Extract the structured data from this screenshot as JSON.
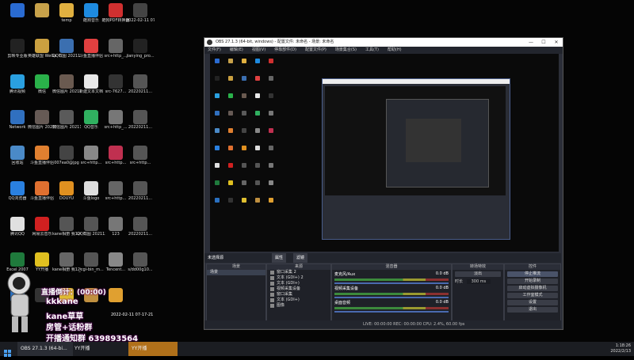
{
  "desktop": {
    "icons": [
      {
        "label": "",
        "color": "#2a6bd1",
        "col": 0,
        "row": 0
      },
      {
        "label": "",
        "color": "#c8a24a",
        "col": 1,
        "row": 0
      },
      {
        "label": "temp",
        "color": "#e0b040",
        "col": 2,
        "row": 0
      },
      {
        "label": "酷狗音乐",
        "color": "#1e8be0",
        "col": 3,
        "row": 0
      },
      {
        "label": "酷狗PDF转换器",
        "color": "#d03030",
        "col": 4,
        "row": 0
      },
      {
        "label": "2022-02-11 07-18-36",
        "color": "#444",
        "col": 5,
        "row": 0
      },
      {
        "label": "剪映专业版",
        "color": "#222",
        "col": 0,
        "row": 1
      },
      {
        "label": "英雄联盟 WeGame版",
        "color": "#caa040",
        "col": 1,
        "row": 1
      },
      {
        "label": "QQ截图 20211218...",
        "color": "#3b6fb0",
        "col": 2,
        "row": 1
      },
      {
        "label": "斗鱼直播伴侣",
        "color": "#e04040",
        "col": 3,
        "row": 1
      },
      {
        "label": "src+http_...",
        "color": "#666",
        "col": 4,
        "row": 1
      },
      {
        "label": "jianying_pro...",
        "color": "#222",
        "col": 5,
        "row": 1
      },
      {
        "label": "腾讯视频",
        "color": "#2aa0e0",
        "col": 0,
        "row": 2
      },
      {
        "label": "微信",
        "color": "#2ab14a",
        "col": 1,
        "row": 2
      },
      {
        "label": "微信图片 20211102...",
        "color": "#6a5a50",
        "col": 2,
        "row": 2
      },
      {
        "label": "新建文本文档",
        "color": "#e8e8e8",
        "col": 3,
        "row": 2
      },
      {
        "label": "src-7627...",
        "color": "#333",
        "col": 4,
        "row": 2
      },
      {
        "label": "20220211...",
        "color": "#555",
        "col": 5,
        "row": 2
      },
      {
        "label": "Network",
        "color": "#3070c0",
        "col": 0,
        "row": 3
      },
      {
        "label": "微信图片 2021110...",
        "color": "#665a55",
        "col": 1,
        "row": 3
      },
      {
        "label": "微信图片 2021110...",
        "color": "#5a5a5a",
        "col": 2,
        "row": 3
      },
      {
        "label": "QQ音乐",
        "color": "#30b060",
        "col": 3,
        "row": 3
      },
      {
        "label": "src+http_...",
        "color": "#777",
        "col": 4,
        "row": 3
      },
      {
        "label": "20220211...",
        "color": "#555",
        "col": 5,
        "row": 3
      },
      {
        "label": "回收站",
        "color": "#4a8ac8",
        "col": 0,
        "row": 4
      },
      {
        "label": "斗鱼直播伴侣",
        "color": "#e08030",
        "col": 1,
        "row": 4
      },
      {
        "label": "007ea0@jpg",
        "color": "#444",
        "col": 2,
        "row": 4
      },
      {
        "label": "src+http...",
        "color": "#888",
        "col": 3,
        "row": 4
      },
      {
        "label": "src+http...",
        "color": "#c03050",
        "col": 4,
        "row": 4
      },
      {
        "label": "src+http...",
        "color": "#555",
        "col": 5,
        "row": 4
      },
      {
        "label": "QQ浏览器",
        "color": "#2a80e0",
        "col": 0,
        "row": 5
      },
      {
        "label": "斗鱼直播伴侣",
        "color": "#e07030",
        "col": 1,
        "row": 5
      },
      {
        "label": "DOUYU",
        "color": "#e09020",
        "col": 2,
        "row": 5
      },
      {
        "label": "斗鱼logo",
        "color": "#ddd",
        "col": 3,
        "row": 5
      },
      {
        "label": "src+http...",
        "color": "#666",
        "col": 4,
        "row": 5
      },
      {
        "label": "20220211...",
        "color": "#555",
        "col": 5,
        "row": 5
      },
      {
        "label": "腾讯QQ",
        "color": "#e0e0e0",
        "col": 0,
        "row": 6
      },
      {
        "label": "网易云音乐",
        "color": "#d02020",
        "col": 1,
        "row": 6
      },
      {
        "label": "kane相册 我1203",
        "color": "#555",
        "col": 2,
        "row": 6
      },
      {
        "label": "QQ截图 20211218...",
        "color": "#555",
        "col": 3,
        "row": 6
      },
      {
        "label": "123",
        "color": "#777",
        "col": 4,
        "row": 6
      },
      {
        "label": "20220211...",
        "color": "#555",
        "col": 5,
        "row": 6
      },
      {
        "label": "Excel 2007",
        "color": "#1f7a3c",
        "col": 0,
        "row": 7
      },
      {
        "label": "YY开播",
        "color": "#e0c020",
        "col": 1,
        "row": 7
      },
      {
        "label": "kane相册 我1203...",
        "color": "#666",
        "col": 2,
        "row": 7
      },
      {
        "label": "_cgi-bin_m...",
        "color": "#555",
        "col": 3,
        "row": 7
      },
      {
        "label": "Tencent...",
        "color": "#888",
        "col": 4,
        "row": 7
      },
      {
        "label": "s/dd00g10...",
        "color": "#555",
        "col": 5,
        "row": 7
      },
      {
        "label": "",
        "color": "#2a70c0",
        "col": 0,
        "row": 8
      },
      {
        "label": "",
        "color": "#333",
        "col": 1,
        "row": 8
      },
      {
        "label": "",
        "color": "#e0c030",
        "col": 2,
        "row": 8
      },
      {
        "label": "",
        "color": "#c09040",
        "col": 3,
        "row": 8
      },
      {
        "label": "",
        "color": "#e0a030",
        "col": 4,
        "row": 8
      }
    ]
  },
  "obs": {
    "title": "OBS 27.1.3 (64-bit, windows) - 配置文件: 未命名 - 场景: 未命名",
    "menu": [
      "文件(F)",
      "编辑(E)",
      "视图(V)",
      "停靠部件(D)",
      "配置文件(P)",
      "场景集合(S)",
      "工具(T)",
      "帮助(H)"
    ],
    "scene_bar": {
      "label": "未选择源",
      "props": "属性",
      "filters": "滤镜"
    },
    "docks": {
      "scenes": {
        "title": "场景",
        "items": [
          "场景"
        ]
      },
      "sources": {
        "title": "来源",
        "items": [
          "窗口采集 2",
          "文本 (GDI+) 2",
          "文本 (GDI+)",
          "视频采集设备",
          "窗口采集",
          "文本 (GDI+)",
          "图像"
        ]
      },
      "mixer": {
        "title": "混音器",
        "channels": [
          {
            "name": "麦克风/Aux",
            "db": "0.0 dB"
          },
          {
            "name": "视频采集设备",
            "db": "0.0 dB"
          },
          {
            "name": "桌面音频",
            "db": "0.0 dB"
          }
        ]
      },
      "transitions": {
        "title": "转场特效",
        "type": "淡出",
        "duration_label": "时长",
        "duration": "300 ms"
      },
      "controls": {
        "title": "控件",
        "buttons": [
          "停止推流",
          "开始录制",
          "启动虚拟摄像机",
          "工作室模式",
          "设置",
          "退出"
        ]
      }
    },
    "status": "LIVE: 00:00:00  REC: 00:00:00  CPU: 2.4%, 60.00 fps"
  },
  "overlay": {
    "line1": "直播倒计：(00:00)",
    "line2": "kkkane",
    "line3": "kane草草",
    "line4": "房管+话粉群",
    "line5": "开播通知群 639893564",
    "date": "2022-02-11 07-17-21"
  },
  "taskbar": {
    "items": [
      "OBS 27.1.3 (64-bi...",
      "YY开播",
      "YY开播"
    ],
    "time": "1:18:26",
    "date": "2022/2/13"
  }
}
